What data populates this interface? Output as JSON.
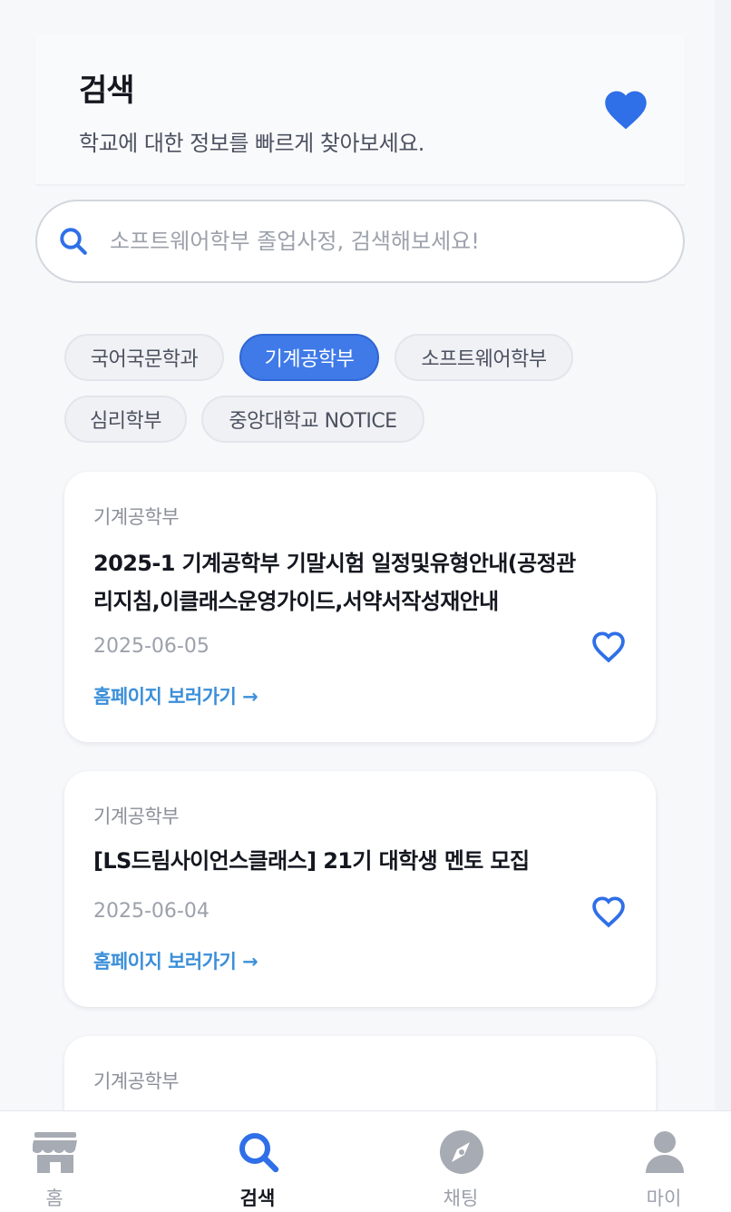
{
  "header": {
    "title": "검색",
    "subtitle": "학교에 대한 정보를 빠르게 찾아보세요.",
    "favorite_icon": "heart-filled-icon"
  },
  "search": {
    "placeholder": "소프트웨어학부 졸업사정, 검색해보세요!",
    "value": ""
  },
  "filters": {
    "chips": [
      "국어국문학과",
      "기계공학부",
      "소프트웨어학부",
      "심리학부",
      "중앙대학교 NOTICE"
    ],
    "selected": "기계공학부"
  },
  "posts": [
    {
      "department": "기계공학부",
      "title_line1": "2025-1 기계공학부 기말시험 일정및유형안내(공정관",
      "title_line2": "리지침,이클래스운영가이드,서약서작성재안내",
      "date": "2025-06-05",
      "link": "홈페이지 보러가기 →"
    },
    {
      "department": "기계공학부",
      "title_line1": "[LS드림사이언스클래스] 21기 대학생 멘토 모집",
      "date": "2025-06-04",
      "link": "홈페이지 보러가기 →"
    },
    {
      "department": "기계공학부"
    }
  ],
  "bottom_nav": {
    "items": [
      {
        "label": "홈",
        "icon": "store-icon"
      },
      {
        "label": "검색",
        "icon": "search-icon"
      },
      {
        "label": "채팅",
        "icon": "compass-icon"
      },
      {
        "label": "마이",
        "icon": "person-icon"
      }
    ],
    "active": "검색"
  },
  "colors": {
    "accent": "#3f7ae8",
    "link": "#3b8fd9",
    "muted": "#9ca1ab"
  }
}
